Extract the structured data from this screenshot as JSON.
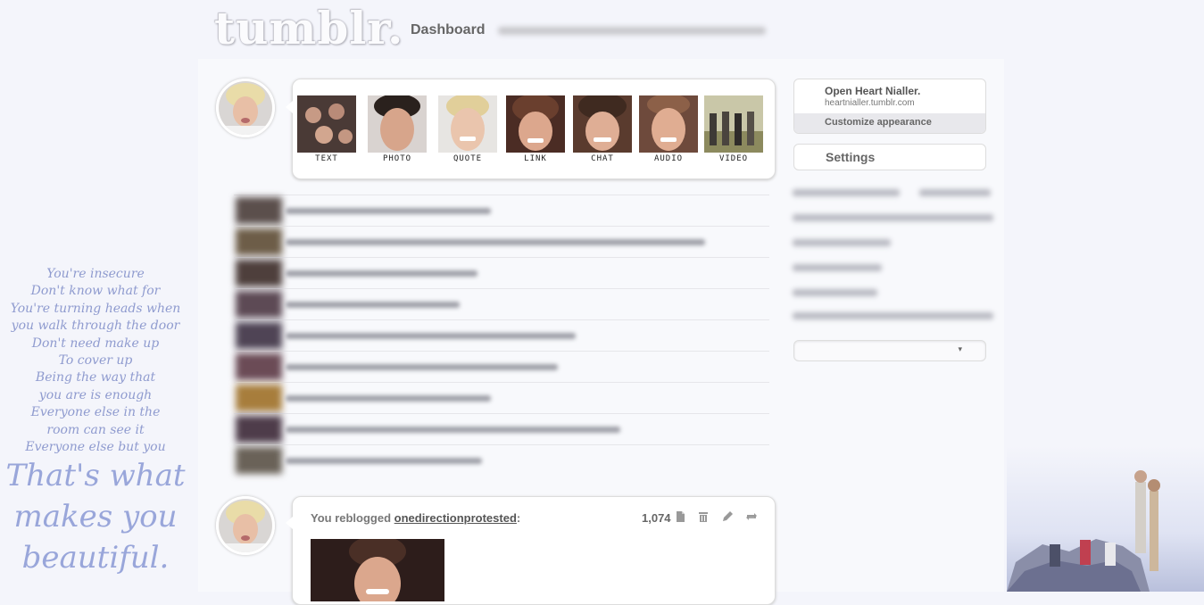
{
  "header": {
    "logo_text": "tumblr.",
    "page_title": "Dashboard"
  },
  "post_types": [
    {
      "label": "TEXT",
      "icon": "text-post-icon"
    },
    {
      "label": "PHOTO",
      "icon": "photo-post-icon"
    },
    {
      "label": "QUOTE",
      "icon": "quote-post-icon"
    },
    {
      "label": "LINK",
      "icon": "link-post-icon"
    },
    {
      "label": "CHAT",
      "icon": "chat-post-icon"
    },
    {
      "label": "AUDIO",
      "icon": "audio-post-icon"
    },
    {
      "label": "VIDEO",
      "icon": "video-post-icon"
    }
  ],
  "sidebar": {
    "blog_title": "Open Heart Nialler.",
    "blog_url": "heartnialler.tumblr.com",
    "customize_label": "Customize appearance",
    "settings_label": "Settings",
    "dropdown_arrow": "▾"
  },
  "lyrics": {
    "lines": [
      "You're insecure",
      "Don't know what for",
      "You're turning heads when",
      "you walk through the door",
      "Don't need make up",
      "To cover up",
      "Being the way that",
      "you are is enough",
      "Everyone else in the",
      "room can see it",
      "Everyone else but you"
    ],
    "big_lines": [
      "That's what",
      "makes you",
      "beautiful."
    ]
  },
  "reblog_post": {
    "prefix": "You reblogged ",
    "username": "onedirectionprotested",
    "suffix": ":",
    "notes_count": "1,074",
    "controls": [
      "notes-icon",
      "delete-icon",
      "edit-icon",
      "reblog-icon"
    ]
  },
  "colors": {
    "background": "#f4f5fb",
    "lyrics": "#8f9bcf",
    "card_border": "#dddddd"
  }
}
